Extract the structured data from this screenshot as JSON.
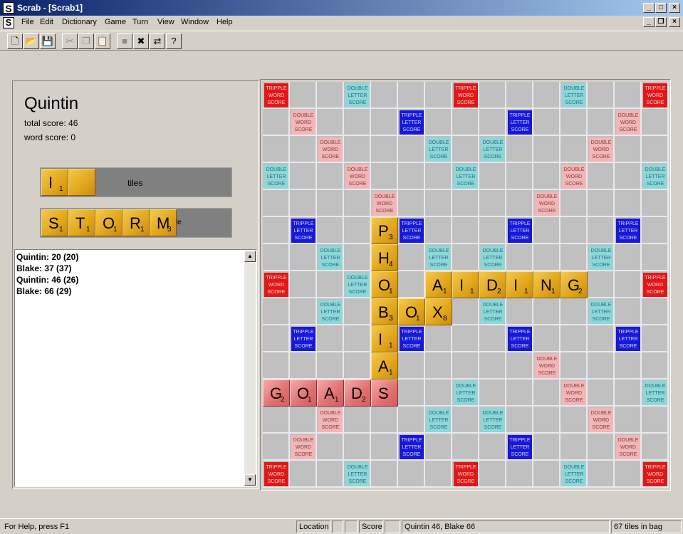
{
  "window": {
    "title": "Scrab - [Scrab1]",
    "app_icon": "S"
  },
  "menu": [
    "File",
    "Edit",
    "Dictionary",
    "Game",
    "Turn",
    "View",
    "Window",
    "Help"
  ],
  "toolbar": [
    {
      "icon": "new-document-icon",
      "glyph": "🗋",
      "enabled": true
    },
    {
      "icon": "open-folder-icon",
      "glyph": "📂",
      "enabled": true
    },
    {
      "icon": "save-icon",
      "glyph": "💾",
      "enabled": true
    },
    {
      "icon": "cut-icon",
      "glyph": "✂",
      "enabled": false
    },
    {
      "icon": "copy-icon",
      "glyph": "❐",
      "enabled": false
    },
    {
      "icon": "paste-icon",
      "glyph": "📋",
      "enabled": false
    },
    {
      "icon": "stop-icon",
      "glyph": "■",
      "enabled": false
    },
    {
      "icon": "cancel-icon",
      "glyph": "✖",
      "enabled": true
    },
    {
      "icon": "swap-icon",
      "glyph": "⇄",
      "enabled": true
    },
    {
      "icon": "help-icon",
      "glyph": "?",
      "enabled": true
    }
  ],
  "player": {
    "name": "Quintin",
    "total_score": "total score: 46",
    "word_score": "word score: 0"
  },
  "rack1": {
    "label": "tiles",
    "tiles": [
      {
        "l": "I",
        "v": "1"
      },
      {
        "l": "",
        "v": ""
      }
    ]
  },
  "rack2": {
    "label_fragment": "le",
    "tiles": [
      {
        "l": "S",
        "v": "1"
      },
      {
        "l": "T",
        "v": "1"
      },
      {
        "l": "O",
        "v": "1"
      },
      {
        "l": "R",
        "v": "1"
      },
      {
        "l": "M",
        "v": "3"
      }
    ]
  },
  "history": [
    "Quintin: 20 (20)",
    "Blake: 37 (37)",
    "Quintin: 46 (26)",
    "Blake: 66 (29)"
  ],
  "premium_labels": {
    "tw": "TRIPPLE WORD SCORE",
    "tl": "TRIPPLE LETTER SCORE",
    "dw": "DOUBLE WORD SCORE",
    "dl": "DOUBLE LETTER SCORE"
  },
  "premiums": {
    "tw": [
      [
        0,
        0
      ],
      [
        0,
        7
      ],
      [
        0,
        14
      ],
      [
        7,
        0
      ],
      [
        7,
        14
      ],
      [
        14,
        0
      ],
      [
        14,
        7
      ],
      [
        14,
        14
      ]
    ],
    "tl": [
      [
        1,
        5
      ],
      [
        1,
        9
      ],
      [
        5,
        1
      ],
      [
        5,
        5
      ],
      [
        5,
        9
      ],
      [
        5,
        13
      ],
      [
        9,
        1
      ],
      [
        9,
        5
      ],
      [
        9,
        9
      ],
      [
        9,
        13
      ],
      [
        13,
        5
      ],
      [
        13,
        9
      ]
    ],
    "dw": [
      [
        1,
        1
      ],
      [
        2,
        2
      ],
      [
        3,
        3
      ],
      [
        4,
        4
      ],
      [
        1,
        13
      ],
      [
        2,
        12
      ],
      [
        3,
        11
      ],
      [
        4,
        10
      ],
      [
        10,
        4
      ],
      [
        11,
        3
      ],
      [
        12,
        2
      ],
      [
        13,
        1
      ],
      [
        10,
        10
      ],
      [
        11,
        11
      ],
      [
        12,
        12
      ],
      [
        13,
        13
      ]
    ],
    "dl": [
      [
        0,
        3
      ],
      [
        0,
        11
      ],
      [
        2,
        6
      ],
      [
        2,
        8
      ],
      [
        3,
        0
      ],
      [
        3,
        7
      ],
      [
        3,
        14
      ],
      [
        6,
        2
      ],
      [
        6,
        6
      ],
      [
        6,
        8
      ],
      [
        6,
        12
      ],
      [
        7,
        3
      ],
      [
        7,
        11
      ],
      [
        8,
        2
      ],
      [
        8,
        6
      ],
      [
        8,
        8
      ],
      [
        8,
        12
      ],
      [
        11,
        0
      ],
      [
        11,
        7
      ],
      [
        11,
        14
      ],
      [
        12,
        6
      ],
      [
        12,
        8
      ],
      [
        14,
        3
      ],
      [
        14,
        11
      ]
    ]
  },
  "placed_tiles": [
    {
      "r": 5,
      "c": 4,
      "l": "P",
      "v": "3"
    },
    {
      "r": 6,
      "c": 4,
      "l": "H",
      "v": "4"
    },
    {
      "r": 7,
      "c": 4,
      "l": "O",
      "v": "1"
    },
    {
      "r": 8,
      "c": 4,
      "l": "B",
      "v": "3"
    },
    {
      "r": 9,
      "c": 4,
      "l": "I",
      "v": "1"
    },
    {
      "r": 10,
      "c": 4,
      "l": "A",
      "v": "1"
    },
    {
      "r": 7,
      "c": 6,
      "l": "A",
      "v": "1"
    },
    {
      "r": 7,
      "c": 7,
      "l": "I",
      "v": "1"
    },
    {
      "r": 7,
      "c": 8,
      "l": "D",
      "v": "2"
    },
    {
      "r": 7,
      "c": 9,
      "l": "I",
      "v": "1"
    },
    {
      "r": 7,
      "c": 10,
      "l": "N",
      "v": "1"
    },
    {
      "r": 7,
      "c": 11,
      "l": "G",
      "v": "2"
    },
    {
      "r": 8,
      "c": 5,
      "l": "O",
      "v": "1"
    },
    {
      "r": 8,
      "c": 6,
      "l": "X",
      "v": "8"
    },
    {
      "r": 11,
      "c": 0,
      "l": "G",
      "v": "2",
      "pending": true
    },
    {
      "r": 11,
      "c": 1,
      "l": "O",
      "v": "1",
      "pending": true
    },
    {
      "r": 11,
      "c": 2,
      "l": "A",
      "v": "1",
      "pending": true
    },
    {
      "r": 11,
      "c": 3,
      "l": "D",
      "v": "2",
      "pending": true
    },
    {
      "r": 11,
      "c": 4,
      "l": "S",
      "v": "",
      "pending": true
    }
  ],
  "status": {
    "help": "For Help, press F1",
    "location": "Location",
    "score_label": "Score",
    "scores": "Quintin 46, Blake 66",
    "bag": "67 tiles in bag"
  },
  "colors": {
    "tw": "#e01818",
    "tl": "#1818d8",
    "dw": "#f3b5b5",
    "dl": "#8fd6d6",
    "tile": "#e8b030",
    "pending_tile": "#e88080"
  }
}
